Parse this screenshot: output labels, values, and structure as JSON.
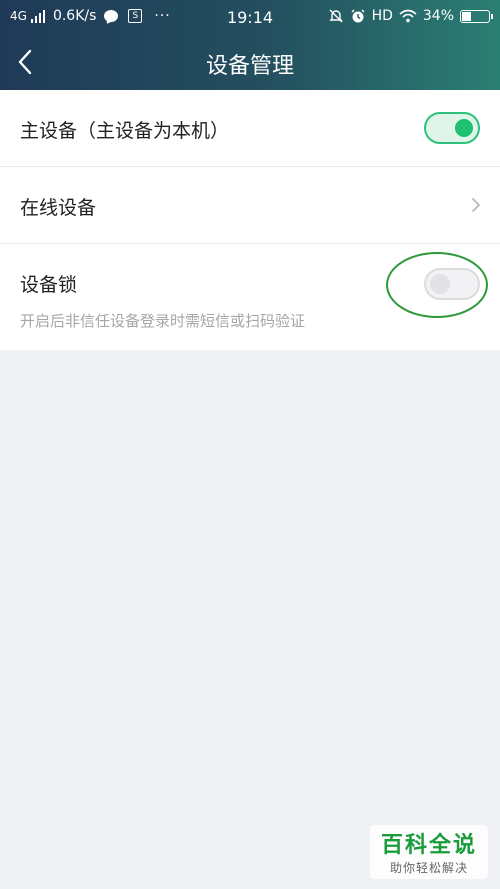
{
  "status_bar": {
    "network": "4G",
    "speed": "0.6K/s",
    "time": "19:14",
    "hd": "HD",
    "battery_text": "34%",
    "battery_level": 0.34,
    "s_icon_glyph": "S",
    "dots": "···"
  },
  "header": {
    "title": "设备管理",
    "background_start": "#1f3a57",
    "background_end": "#2b7f73"
  },
  "settings": {
    "primary_device": {
      "label": "主设备（主设备为本机）",
      "toggle_on": true
    },
    "online_devices": {
      "label": "在线设备"
    },
    "device_lock": {
      "label": "设备锁",
      "description": "开启后非信任设备登录时需短信或扫码验证",
      "toggle_on": false
    }
  },
  "watermark": {
    "title": "百科全说",
    "subtitle": "助你轻松解决"
  },
  "colors": {
    "accent_green": "#1ec16f",
    "highlight_ring": "#2f9a3c"
  }
}
